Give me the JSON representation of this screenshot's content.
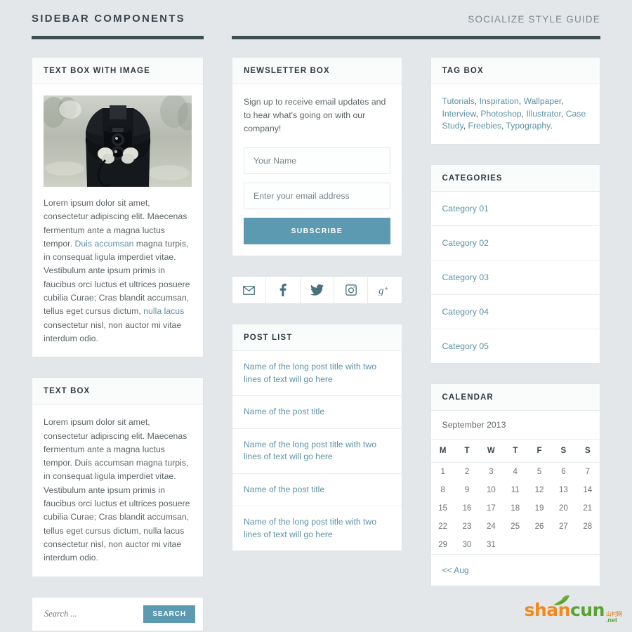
{
  "header": {
    "title": "SIDEBAR COMPONENTS",
    "subtitle": "SOCIALIZE STYLE GUIDE"
  },
  "colors": {
    "accent": "#5b9ab0",
    "link": "#5c93a4",
    "rule": "#3d4f53",
    "background": "#e3e7e9",
    "card": "#ffffff",
    "heading": "#2f3b40"
  },
  "text_box_with_image": {
    "title": "TEXT BOX WITH IMAGE",
    "image_alt": "Person in dark coat holding a vintage twin-lens camera outdoors",
    "paragraph_1": "Lorem ipsum dolor sit amet, consectetur adipiscing elit. Maecenas fermentum ante a magna luctus tempor. ",
    "link_1": "Duis accumsan",
    "paragraph_2": " magna turpis, in consequat ligula imperdiet vitae. Vestibulum ante ipsum primis in faucibus orci luctus et ultrices posuere cubilia Curae; Cras blandit accumsan, tellus eget cursus dictum, ",
    "link_2": "nulla lacus",
    "paragraph_3": " consectetur nisl, non auctor mi vitae interdum odio."
  },
  "text_box": {
    "title": "TEXT BOX",
    "paragraph": "Lorem ipsum dolor sit amet, consectetur adipiscing elit. Maecenas fermentum ante a magna luctus tempor. Duis accumsan magna turpis, in consequat ligula imperdiet vitae. Vestibulum ante ipsum primis in faucibus orci luctus et ultrices posuere cubilia Curae; Cras blandit accumsan, tellus eget cursus dictum, nulla lacus consectetur nisl, non auctor mi vitae interdum odio."
  },
  "search": {
    "placeholder": "Search ...",
    "value": "",
    "button_label": "SEARCH"
  },
  "newsletter": {
    "title": "NEWSLETTER BOX",
    "description": "Sign up to receive email updates and to hear what's going on with our company!",
    "name_placeholder": "Your Name",
    "name_value": "",
    "email_placeholder": "Enter your email address",
    "email_value": "",
    "button_label": "SUBSCRIBE"
  },
  "social": {
    "items": [
      {
        "name": "email-icon",
        "label": "Email"
      },
      {
        "name": "facebook-icon",
        "label": "Facebook"
      },
      {
        "name": "twitter-icon",
        "label": "Twitter"
      },
      {
        "name": "instagram-icon",
        "label": "Instagram"
      },
      {
        "name": "google-plus-icon",
        "label": "Google Plus"
      }
    ]
  },
  "post_list": {
    "title": "POST LIST",
    "items": [
      "Name of the long post title with two lines of text will go here",
      "Name of the post title",
      "Name of the long post title with two lines of text will go here",
      "Name of the post title",
      "Name of the long post title with two lines of text will go here"
    ]
  },
  "tag_box": {
    "title": "TAG BOX",
    "tags": [
      "Tutorials",
      "Inspiration",
      "Wallpaper",
      "Interview",
      "Photoshop",
      "Illustrator",
      "Case Study",
      "Freebies",
      "Typography"
    ]
  },
  "categories": {
    "title": "CATEGORIES",
    "items": [
      "Category 01",
      "Category 02",
      "Category 03",
      "Category 04",
      "Category 05"
    ]
  },
  "calendar": {
    "title": "CALENDAR",
    "month_label": "September 2013",
    "weekday_headers": [
      "M",
      "T",
      "W",
      "T",
      "F",
      "S",
      "S"
    ],
    "weeks": [
      [
        "1",
        "2",
        "3",
        "4",
        "5",
        "6",
        "7"
      ],
      [
        "8",
        "9",
        "10",
        "11",
        "12",
        "13",
        "14"
      ],
      [
        "15",
        "16",
        "17",
        "18",
        "19",
        "20",
        "21"
      ],
      [
        "22",
        "23",
        "24",
        "25",
        "26",
        "27",
        "28"
      ],
      [
        "29",
        "30",
        "31",
        "",
        "",
        "",
        ""
      ]
    ],
    "prev_link": "<< Aug"
  },
  "watermark": {
    "part_1": "shan",
    "part_2": "cun",
    "sub_1": "山村网",
    "sub_2": ".net"
  }
}
